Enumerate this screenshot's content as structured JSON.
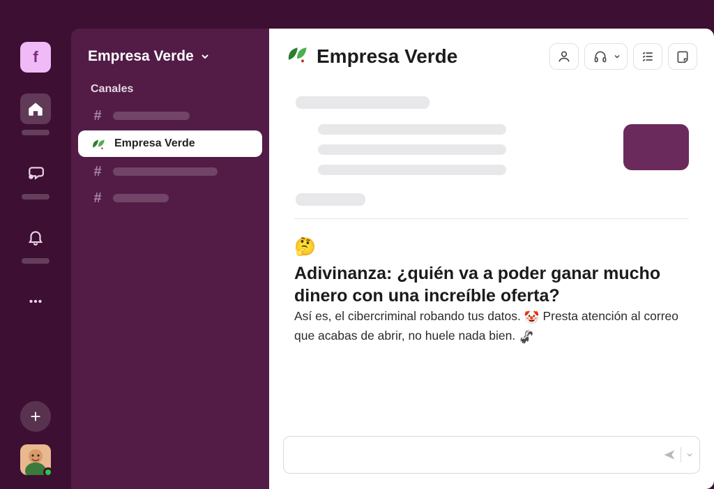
{
  "workspace": {
    "name": "Empresa Verde"
  },
  "rail": {
    "tile_letter": "f"
  },
  "sidebar": {
    "section_label": "Canales",
    "selected_channel": "Empresa Verde"
  },
  "header": {
    "channel_title": "Empresa Verde"
  },
  "post": {
    "riddle_emoji": "🤔",
    "title_text": "Adivinanza: ¿quién va a poder ganar mucho dinero con una increíble oferta?",
    "body_before_clown": "Así es, el cibercriminal robando tus datos.",
    "clown_emoji": "🤡",
    "body_after_clown": "Presta atención al correo que acabas de abrir, no huele nada bien.",
    "skunk_emoji": "🦨"
  },
  "composer": {
    "placeholder": ""
  }
}
